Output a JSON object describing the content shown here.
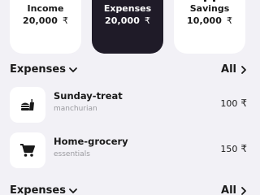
{
  "summary": {
    "cards": [
      {
        "label": "Income",
        "amount": "20,000",
        "currency": "₹"
      },
      {
        "label": "Expenses",
        "amount": "20,000",
        "currency": "₹"
      },
      {
        "label": "Savings",
        "amount": "10,000",
        "currency": "₹"
      }
    ]
  },
  "sections": [
    {
      "title": "Expenses",
      "all_label": "All",
      "items": [
        {
          "title": "Sunday-treat",
          "subtitle": "manchurian",
          "amount": "100",
          "currency": "₹",
          "icon": "fastfood-icon"
        },
        {
          "title": "Home-grocery",
          "subtitle": "essentials",
          "amount": "150",
          "currency": "₹",
          "icon": "shopping-cart-icon"
        }
      ]
    },
    {
      "title": "Expenses",
      "all_label": "All"
    }
  ],
  "colors": {
    "background": "#f2f1f6",
    "card": "#ffffff",
    "active_card": "#1f1b28",
    "text_primary": "#1a1a1a",
    "text_secondary": "#9a9a9f"
  }
}
